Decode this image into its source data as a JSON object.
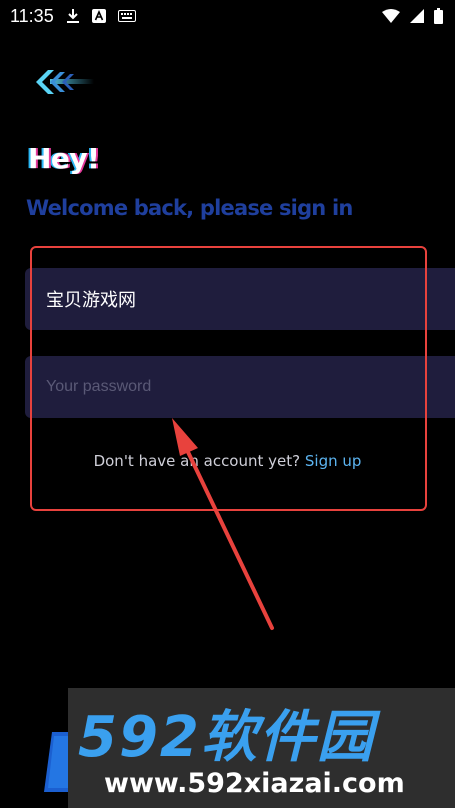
{
  "status_bar": {
    "time": "11:35",
    "left_icons": [
      "download-icon",
      "text-a-icon",
      "keyboard-icon"
    ],
    "right_icons": [
      "wifi-icon",
      "signal-icon",
      "battery-icon"
    ]
  },
  "header": {
    "back_icon": "chevron-left-icon",
    "greeting": "Hey!",
    "subtitle": "Welcome back, please sign in"
  },
  "form": {
    "username_value": "宝贝游戏网",
    "password_placeholder": "Your password",
    "signup_prompt": "Don't have an account yet?",
    "signup_link": "Sign up"
  },
  "watermark": {
    "title": "592软件园",
    "url": "www.592xiazai.com"
  },
  "colors": {
    "background": "#000000",
    "field_background": "#1f1d3d",
    "subtitle": "#1f3f9d",
    "link": "#5cb4f0",
    "annotation": "#e8423d",
    "watermark_blue": "#3aa0ef"
  }
}
